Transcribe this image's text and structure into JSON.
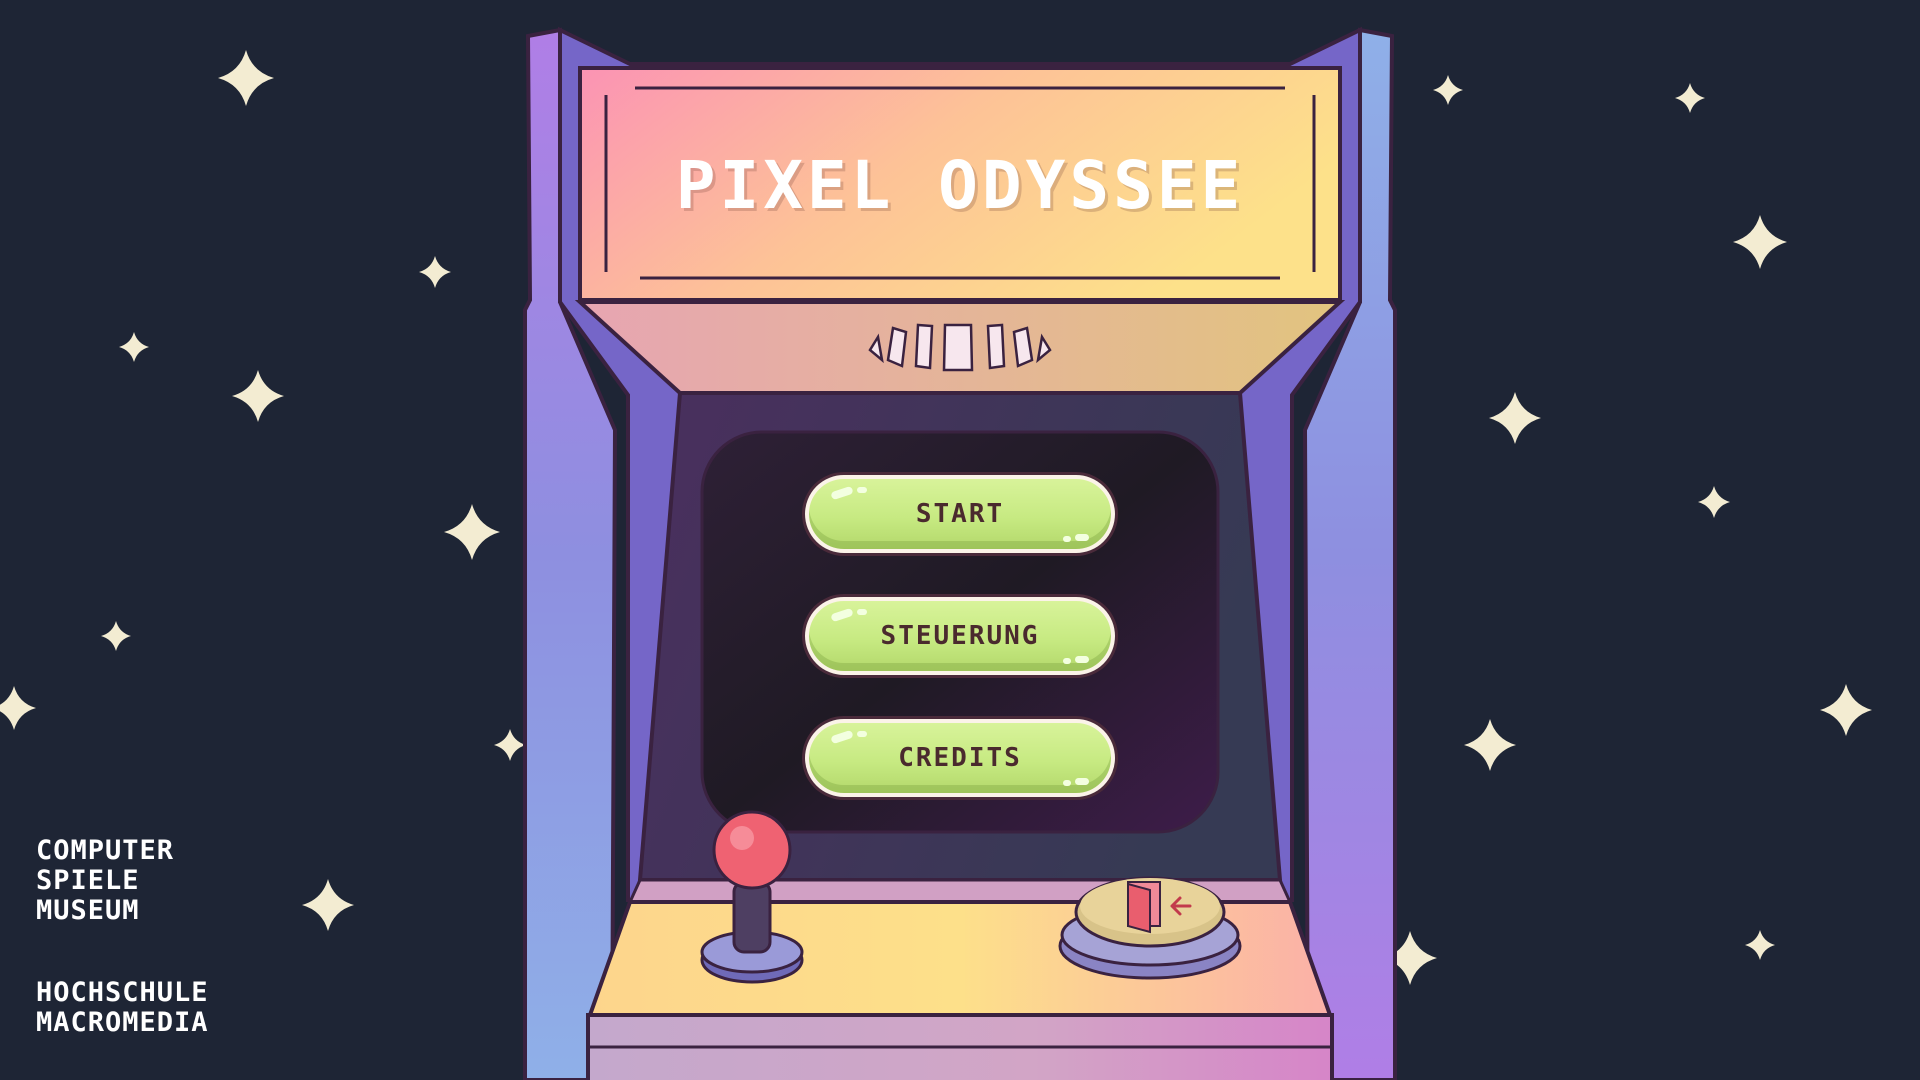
{
  "game": {
    "title": "PIXEL ODYSSEE"
  },
  "menu": {
    "buttons": [
      {
        "label": "START"
      },
      {
        "label": "STEUERUNG"
      },
      {
        "label": "CREDITS"
      }
    ]
  },
  "logos": {
    "museum": [
      "COMPUTER",
      "SPIELE",
      "MUSEUM"
    ],
    "school": [
      "HOCHSCHULE",
      "MACROMEDIA"
    ]
  },
  "icons": {
    "joystick": "joystick-icon",
    "exit_button": "exit-door-icon",
    "speaker": "speaker-grille-icon"
  },
  "colors": {
    "background": "#1e2535",
    "star": "#f3ecd2",
    "button_green": "#c7ea82",
    "button_text": "#4a2a2e"
  }
}
